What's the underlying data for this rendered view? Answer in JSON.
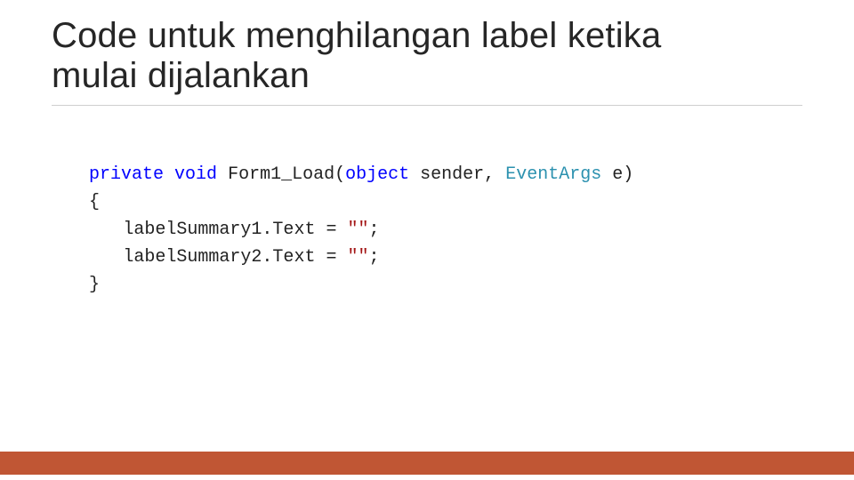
{
  "title_line1": "Code untuk menghilangan label ketika",
  "title_line2": "mulai dijalankan",
  "code": {
    "kw_private": "private",
    "kw_void": "void",
    "method": "Form1_Load",
    "lparen": "(",
    "kw_object": "object",
    "param1": "sender",
    "comma": ",",
    "type_eventargs": "EventArgs",
    "param2": "e",
    "rparen": ")",
    "brace_open": "{",
    "line1_a": "labelSummary1.Text",
    "line1_op": " = ",
    "line1_str": "\"\"",
    "semi": ";",
    "line2_a": "labelSummary2.Text",
    "line2_op": " = ",
    "line2_str": "\"\"",
    "brace_close": "}"
  }
}
